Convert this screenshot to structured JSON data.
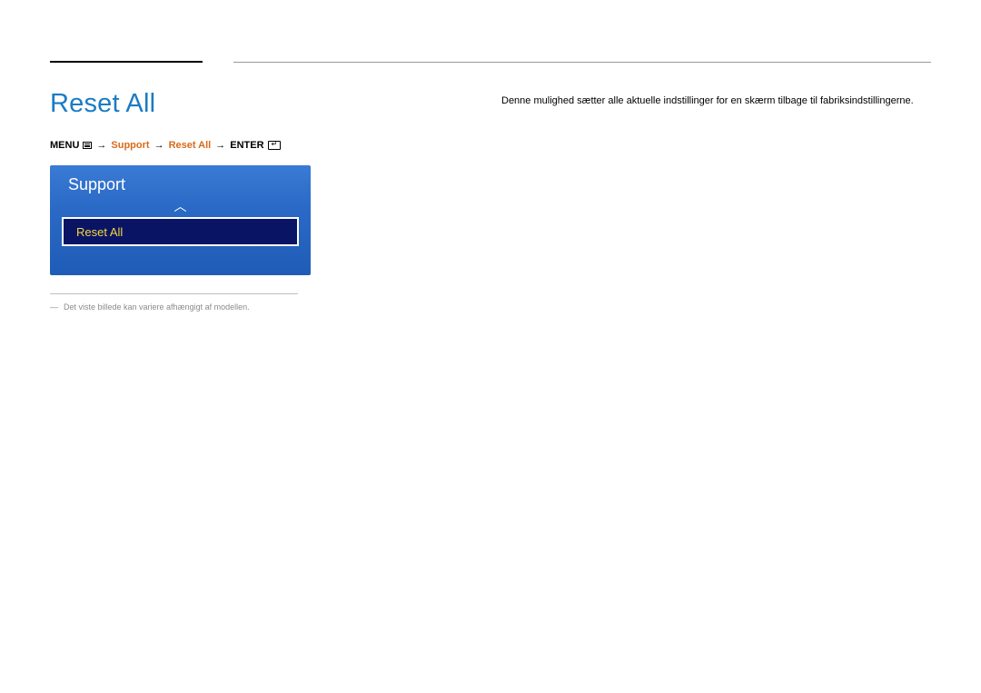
{
  "title": "Reset All",
  "breadcrumb": {
    "menu_label": "MENU",
    "path1": "Support",
    "path2": "Reset All",
    "enter_label": "ENTER",
    "arrow": "→"
  },
  "menu_panel": {
    "header": "Support",
    "up_arrow": "︿",
    "selected_item": "Reset All"
  },
  "footnote": {
    "dash": "―",
    "text": "Det viste billede kan variere afhængigt af modellen."
  },
  "description": "Denne mulighed sætter alle aktuelle indstillinger for en skærm tilbage til fabriksindstillingerne."
}
